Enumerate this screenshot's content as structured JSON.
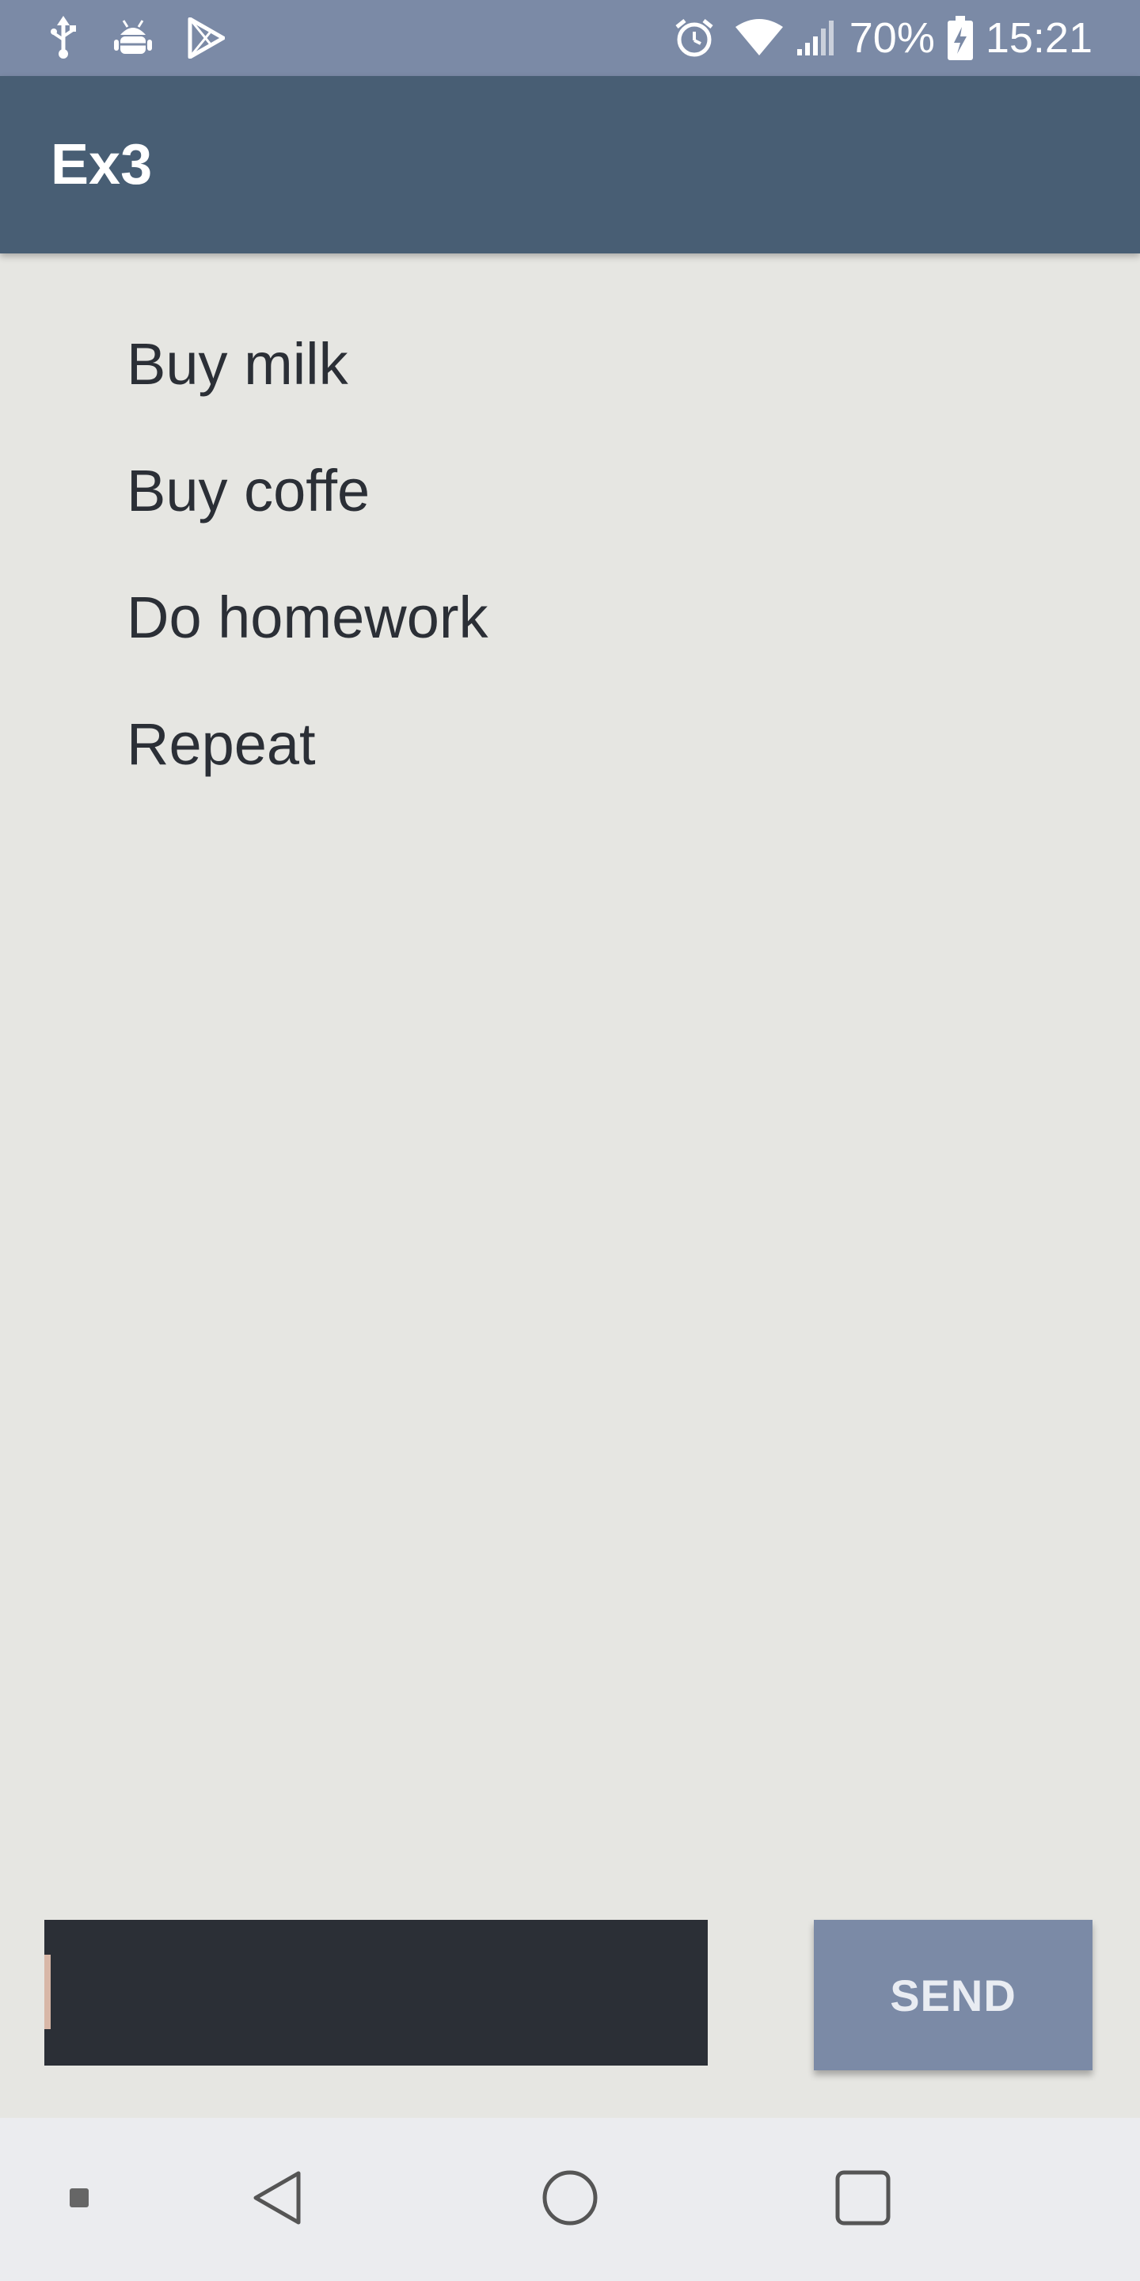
{
  "status_bar": {
    "icons_left": [
      "usb-icon",
      "android-debug-icon",
      "play-store-icon"
    ],
    "icons_right": [
      "alarm-icon",
      "wifi-icon",
      "signal-icon",
      "battery-charging-icon"
    ],
    "battery_percent": "70%",
    "time": "15:21"
  },
  "app_bar": {
    "title": "Ex3"
  },
  "tasks": {
    "items": [
      "Buy milk",
      "Buy coffe",
      "Do homework",
      "Repeat"
    ]
  },
  "composer": {
    "input_value": "",
    "send_label": "SEND"
  },
  "nav_bar": {
    "buttons": [
      "menu-dot-icon",
      "back-icon",
      "home-icon",
      "recents-icon"
    ]
  },
  "colors": {
    "status_bar": "#7b8aa6",
    "app_bar": "#485e74",
    "background": "#e6e6e2",
    "input_bg": "#2b2f36",
    "send_button": "#7b8aa6",
    "nav_bar": "#ebecef"
  }
}
